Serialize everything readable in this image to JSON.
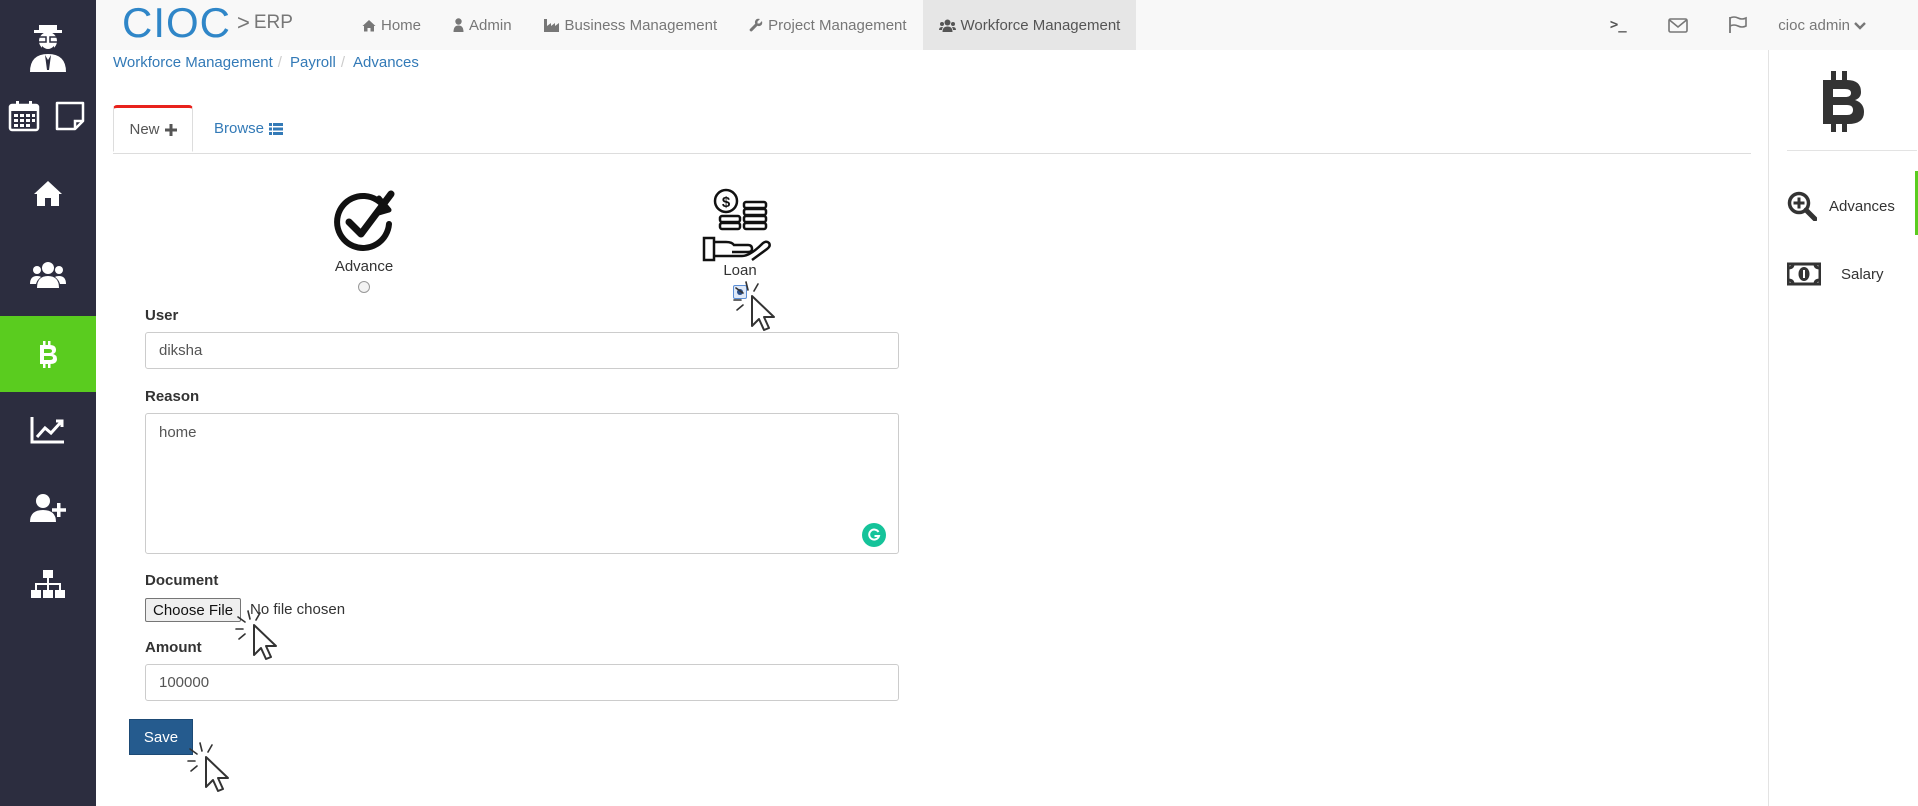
{
  "app": {
    "brand_logo": "CIOC",
    "brand_separator": ">",
    "brand_sub": "ERP"
  },
  "nav": {
    "items": [
      {
        "label": "Home",
        "icon": "home-icon"
      },
      {
        "label": "Admin",
        "icon": "user-icon"
      },
      {
        "label": "Business Management",
        "icon": "industry-icon"
      },
      {
        "label": "Project Management",
        "icon": "wrench-icon"
      },
      {
        "label": "Workforce Management",
        "icon": "users-icon",
        "active": true
      }
    ],
    "terminal_glyph": ">_",
    "user_label": "cioc admin"
  },
  "breadcrumb": [
    "Workforce Management",
    "Payroll",
    "Advances"
  ],
  "tabs": {
    "new_label": "New",
    "browse_label": "Browse"
  },
  "type_options": {
    "advance_label": "Advance",
    "loan_label": "Loan",
    "selected": "Loan"
  },
  "form": {
    "user_label": "User",
    "user_value": "diksha",
    "reason_label": "Reason",
    "reason_value": "home",
    "document_label": "Document",
    "file_button": "Choose File",
    "file_status": "No file chosen",
    "amount_label": "Amount",
    "amount_value": "100000",
    "save_label": "Save"
  },
  "right_panel": {
    "items": [
      {
        "label": "Advances",
        "icon": "search-plus-icon"
      },
      {
        "label": "Salary",
        "icon": "money-icon"
      }
    ]
  },
  "colors": {
    "sidebar_bg": "#2c2d3f",
    "sidebar_active": "#5acc1f",
    "brand_blue": "#2f86c8",
    "link_blue": "#337ab7",
    "save_button": "#255b8e",
    "tab_accent": "#e8221c"
  }
}
